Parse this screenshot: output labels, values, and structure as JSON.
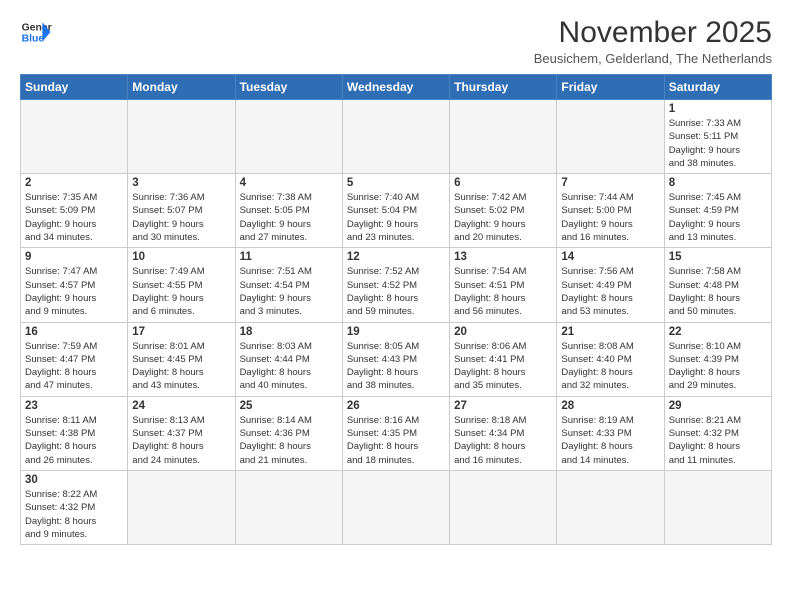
{
  "logo": {
    "line1": "General",
    "line2": "Blue"
  },
  "title": "November 2025",
  "subtitle": "Beusichem, Gelderland, The Netherlands",
  "days_of_week": [
    "Sunday",
    "Monday",
    "Tuesday",
    "Wednesday",
    "Thursday",
    "Friday",
    "Saturday"
  ],
  "weeks": [
    [
      {
        "day": "",
        "info": ""
      },
      {
        "day": "",
        "info": ""
      },
      {
        "day": "",
        "info": ""
      },
      {
        "day": "",
        "info": ""
      },
      {
        "day": "",
        "info": ""
      },
      {
        "day": "",
        "info": ""
      },
      {
        "day": "1",
        "info": "Sunrise: 7:33 AM\nSunset: 5:11 PM\nDaylight: 9 hours\nand 38 minutes."
      }
    ],
    [
      {
        "day": "2",
        "info": "Sunrise: 7:35 AM\nSunset: 5:09 PM\nDaylight: 9 hours\nand 34 minutes."
      },
      {
        "day": "3",
        "info": "Sunrise: 7:36 AM\nSunset: 5:07 PM\nDaylight: 9 hours\nand 30 minutes."
      },
      {
        "day": "4",
        "info": "Sunrise: 7:38 AM\nSunset: 5:05 PM\nDaylight: 9 hours\nand 27 minutes."
      },
      {
        "day": "5",
        "info": "Sunrise: 7:40 AM\nSunset: 5:04 PM\nDaylight: 9 hours\nand 23 minutes."
      },
      {
        "day": "6",
        "info": "Sunrise: 7:42 AM\nSunset: 5:02 PM\nDaylight: 9 hours\nand 20 minutes."
      },
      {
        "day": "7",
        "info": "Sunrise: 7:44 AM\nSunset: 5:00 PM\nDaylight: 9 hours\nand 16 minutes."
      },
      {
        "day": "8",
        "info": "Sunrise: 7:45 AM\nSunset: 4:59 PM\nDaylight: 9 hours\nand 13 minutes."
      }
    ],
    [
      {
        "day": "9",
        "info": "Sunrise: 7:47 AM\nSunset: 4:57 PM\nDaylight: 9 hours\nand 9 minutes."
      },
      {
        "day": "10",
        "info": "Sunrise: 7:49 AM\nSunset: 4:55 PM\nDaylight: 9 hours\nand 6 minutes."
      },
      {
        "day": "11",
        "info": "Sunrise: 7:51 AM\nSunset: 4:54 PM\nDaylight: 9 hours\nand 3 minutes."
      },
      {
        "day": "12",
        "info": "Sunrise: 7:52 AM\nSunset: 4:52 PM\nDaylight: 8 hours\nand 59 minutes."
      },
      {
        "day": "13",
        "info": "Sunrise: 7:54 AM\nSunset: 4:51 PM\nDaylight: 8 hours\nand 56 minutes."
      },
      {
        "day": "14",
        "info": "Sunrise: 7:56 AM\nSunset: 4:49 PM\nDaylight: 8 hours\nand 53 minutes."
      },
      {
        "day": "15",
        "info": "Sunrise: 7:58 AM\nSunset: 4:48 PM\nDaylight: 8 hours\nand 50 minutes."
      }
    ],
    [
      {
        "day": "16",
        "info": "Sunrise: 7:59 AM\nSunset: 4:47 PM\nDaylight: 8 hours\nand 47 minutes."
      },
      {
        "day": "17",
        "info": "Sunrise: 8:01 AM\nSunset: 4:45 PM\nDaylight: 8 hours\nand 43 minutes."
      },
      {
        "day": "18",
        "info": "Sunrise: 8:03 AM\nSunset: 4:44 PM\nDaylight: 8 hours\nand 40 minutes."
      },
      {
        "day": "19",
        "info": "Sunrise: 8:05 AM\nSunset: 4:43 PM\nDaylight: 8 hours\nand 38 minutes."
      },
      {
        "day": "20",
        "info": "Sunrise: 8:06 AM\nSunset: 4:41 PM\nDaylight: 8 hours\nand 35 minutes."
      },
      {
        "day": "21",
        "info": "Sunrise: 8:08 AM\nSunset: 4:40 PM\nDaylight: 8 hours\nand 32 minutes."
      },
      {
        "day": "22",
        "info": "Sunrise: 8:10 AM\nSunset: 4:39 PM\nDaylight: 8 hours\nand 29 minutes."
      }
    ],
    [
      {
        "day": "23",
        "info": "Sunrise: 8:11 AM\nSunset: 4:38 PM\nDaylight: 8 hours\nand 26 minutes."
      },
      {
        "day": "24",
        "info": "Sunrise: 8:13 AM\nSunset: 4:37 PM\nDaylight: 8 hours\nand 24 minutes."
      },
      {
        "day": "25",
        "info": "Sunrise: 8:14 AM\nSunset: 4:36 PM\nDaylight: 8 hours\nand 21 minutes."
      },
      {
        "day": "26",
        "info": "Sunrise: 8:16 AM\nSunset: 4:35 PM\nDaylight: 8 hours\nand 18 minutes."
      },
      {
        "day": "27",
        "info": "Sunrise: 8:18 AM\nSunset: 4:34 PM\nDaylight: 8 hours\nand 16 minutes."
      },
      {
        "day": "28",
        "info": "Sunrise: 8:19 AM\nSunset: 4:33 PM\nDaylight: 8 hours\nand 14 minutes."
      },
      {
        "day": "29",
        "info": "Sunrise: 8:21 AM\nSunset: 4:32 PM\nDaylight: 8 hours\nand 11 minutes."
      }
    ],
    [
      {
        "day": "30",
        "info": "Sunrise: 8:22 AM\nSunset: 4:32 PM\nDaylight: 8 hours\nand 9 minutes."
      },
      {
        "day": "",
        "info": ""
      },
      {
        "day": "",
        "info": ""
      },
      {
        "day": "",
        "info": ""
      },
      {
        "day": "",
        "info": ""
      },
      {
        "day": "",
        "info": ""
      },
      {
        "day": "",
        "info": ""
      }
    ]
  ]
}
